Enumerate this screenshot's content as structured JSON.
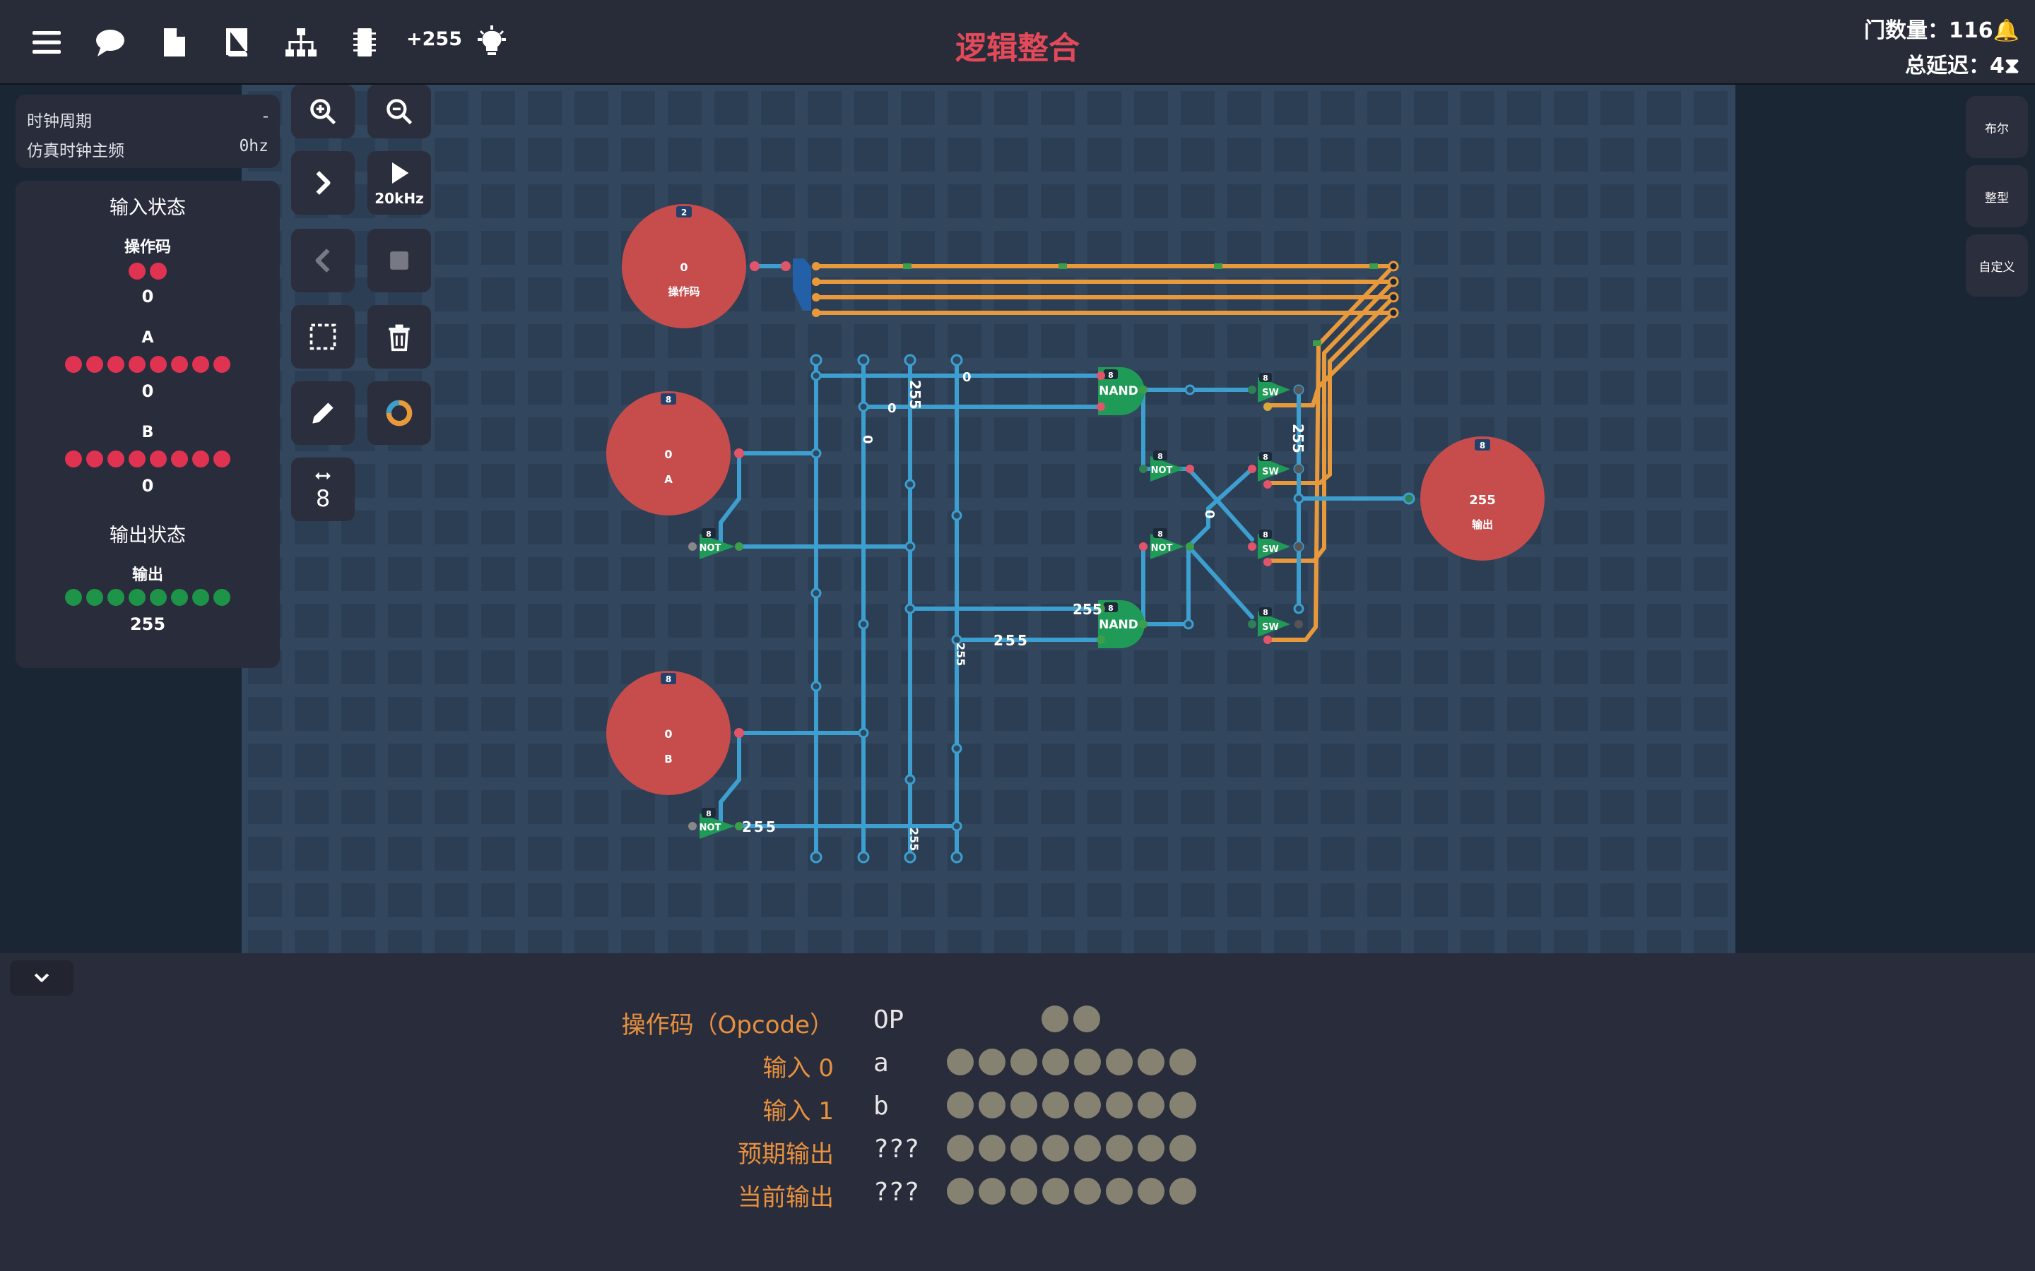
{
  "app": {
    "title": "逻辑整合"
  },
  "toolbar": {
    "counter": "+255"
  },
  "stats": {
    "gates": "门数量：116",
    "delay": "总延迟：4"
  },
  "clock": {
    "period_label": "时钟周期",
    "period_value": "-",
    "freq_label": "仿真时钟主频",
    "freq_value": "0hz"
  },
  "input_state": {
    "title": "输入状态",
    "opcode_label": "操作码",
    "opcode_value": "0",
    "a_label": "A",
    "a_value": "0",
    "b_label": "B",
    "b_value": "0"
  },
  "output_state": {
    "title": "输出状态",
    "label": "输出",
    "value": "255"
  },
  "controls": {
    "speed_label": "20kHz",
    "width_label": "8"
  },
  "right_panel": {
    "bool": "布尔",
    "int": "整型",
    "custom": "自定义"
  },
  "canvas": {
    "pin_opcode": {
      "badge": "2",
      "value": "0",
      "name": "操作码"
    },
    "pin_a": {
      "badge": "8",
      "value": "0",
      "name": "A"
    },
    "pin_b": {
      "badge": "8",
      "value": "0",
      "name": "B"
    },
    "pin_out": {
      "badge": "8",
      "value": "255",
      "name": "输出"
    },
    "gate_width": "8",
    "nand_label": "NAND",
    "not_label": "NOT",
    "sw_label": "SW",
    "wire_labels": {
      "w1": "255",
      "w2": "0",
      "w3": "0",
      "w4": "0",
      "w5": "255",
      "w6": "0",
      "w7": "255",
      "w8": "255",
      "w9": "255",
      "w10": "255",
      "w11": "255"
    }
  },
  "truth_table": {
    "rows": [
      {
        "label": "操作码（Opcode）",
        "code": "OP",
        "dots": 2
      },
      {
        "label": "输入 0",
        "code": "a",
        "dots": 8
      },
      {
        "label": "输入 1",
        "code": "b",
        "dots": 8
      },
      {
        "label": "预期输出",
        "code": "???",
        "dots": 8
      },
      {
        "label": "当前输出",
        "code": "???",
        "dots": 8
      }
    ]
  },
  "colors": {
    "wire_blue": "#3c9fcf",
    "wire_orange": "#e8993b",
    "pin_red": "#c74d4d",
    "gate_green": "#1f9a57",
    "title_red": "#e24a5a",
    "label_orange": "#e7913f"
  }
}
